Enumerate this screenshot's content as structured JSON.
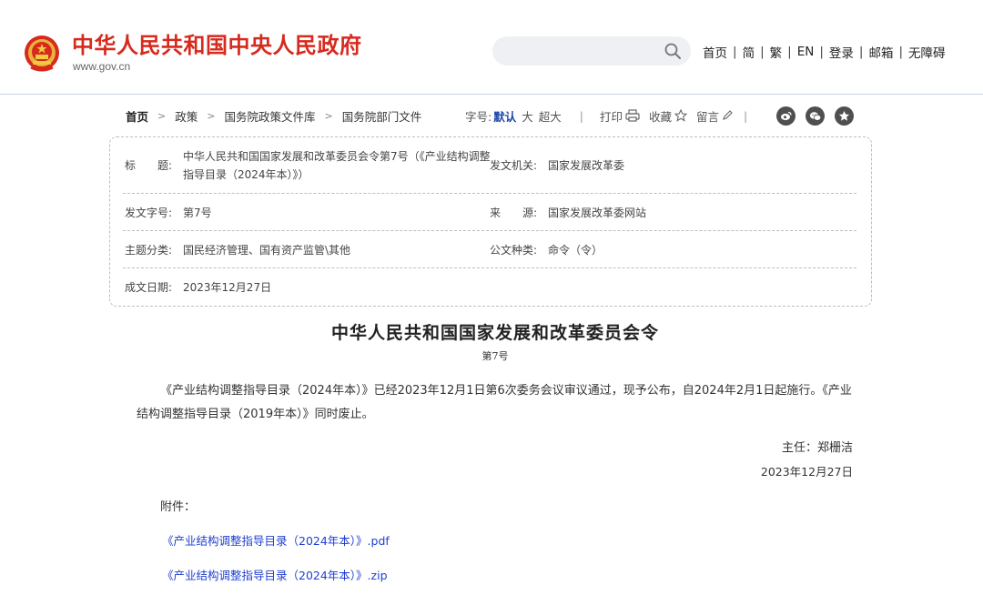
{
  "header": {
    "site_title": "中华人民共和国中央人民政府",
    "site_url": "www.gov.cn",
    "search_placeholder": "",
    "nav": [
      "首页",
      "简",
      "繁",
      "EN",
      "登录",
      "邮箱",
      "无障碍"
    ]
  },
  "breadcrumb": {
    "items": [
      "首页",
      "政策",
      "国务院政策文件库",
      "国务院部门文件"
    ]
  },
  "tools": {
    "font_size_label": "字号:",
    "font_default": "默认",
    "font_large": "大",
    "font_xlarge": "超大",
    "separator": "|",
    "print": "打印",
    "favorite": "收藏",
    "comment": "留言"
  },
  "share": [
    "weibo-icon",
    "wechat-icon",
    "favorite-star-icon"
  ],
  "info": {
    "title_label": "标　　题:",
    "title_value": "中华人民共和国国家发展和改革委员会令第7号（《产业结构调整指导目录（2024年本）》）",
    "issuer_label": "发文机关:",
    "issuer_value": "国家发展改革委",
    "doc_no_label": "发文字号:",
    "doc_no_value": "第7号",
    "source_label": "来　　源:",
    "source_value": "国家发展改革委网站",
    "topic_label": "主题分类:",
    "topic_value": "国民经济管理、国有资产监管\\其他",
    "type_label": "公文种类:",
    "type_value": "命令（令）",
    "date_label": "成文日期:",
    "date_value": "2023年12月27日"
  },
  "article": {
    "title": "中华人民共和国国家发展和改革委员会令",
    "number": "第7号",
    "body": "《产业结构调整指导目录（2024年本）》已经2023年12月1日第6次委务会议审议通过，现予公布，自2024年2月1日起施行。《产业结构调整指导目录（2019年本）》同时废止。",
    "signer": "主任：郑栅洁",
    "date": "2023年12月27日",
    "attachments_label": "附件：",
    "attachments": [
      "《产业结构调整指导目录（2024年本）》.pdf",
      "《产业结构调整指导目录（2024年本）》.zip"
    ]
  },
  "colors": {
    "brand_red": "#d72a1e",
    "link_blue": "#1f3fd0",
    "active_blue": "#1f4aa8"
  }
}
